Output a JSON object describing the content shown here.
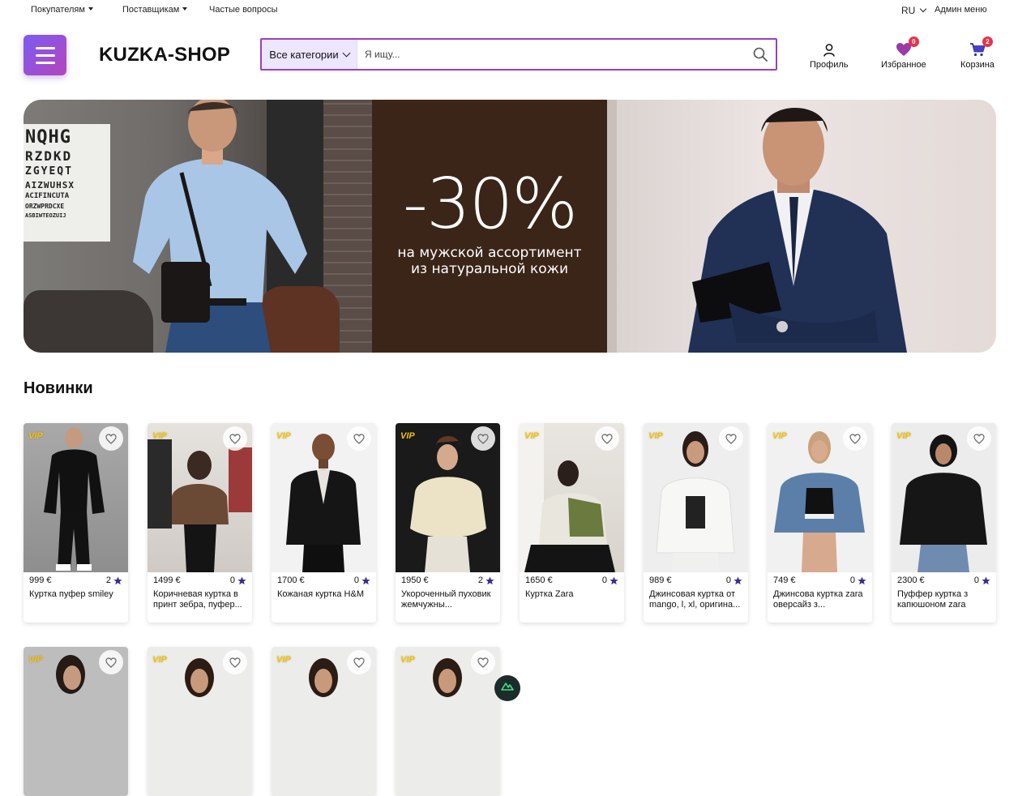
{
  "topbar": {
    "buyers": "Покупателям",
    "suppliers": "Поставщикам",
    "faq": "Частые вопросы",
    "lang": "RU",
    "admin": "Админ меню"
  },
  "header": {
    "logo": "KUZKA-SHOP",
    "category_select": "Все категории",
    "search_placeholder": "Я ищу...",
    "profile": "Профиль",
    "favorites": "Избранное",
    "favorites_count": "0",
    "cart": "Корзина",
    "cart_count": "2"
  },
  "banner": {
    "percent": "-30%",
    "line1": "на мужской ассортимент",
    "line2": "из натуральной кожи",
    "eye_chart": [
      "NQHG",
      "RZDKD",
      "ZGYEQT",
      "AIZWUHSX",
      "ACIFINCUTA",
      "ORZWPRDCXE",
      "ASBIWTEOZUIJ"
    ]
  },
  "section": {
    "title": "Новинки"
  },
  "vip_label": "VIP",
  "products": [
    {
      "price": "999 €",
      "rating": "2",
      "name": "Куртка пуфер smiley"
    },
    {
      "price": "1499 €",
      "rating": "0",
      "name": "Коричневая куртка в принт зебра, пуфер..."
    },
    {
      "price": "1700 €",
      "rating": "0",
      "name": "Кожаная куртка H&M"
    },
    {
      "price": "1950 €",
      "rating": "2",
      "name": "Укороченный пуховик жемчужны..."
    },
    {
      "price": "1650 €",
      "rating": "0",
      "name": "Куртка Zara"
    },
    {
      "price": "989 €",
      "rating": "0",
      "name": "Джинсовая куртка от mango, l, xl, оригина..."
    },
    {
      "price": "749 €",
      "rating": "0",
      "name": "Джинсова куртка zara оверсайз з..."
    },
    {
      "price": "2300 €",
      "rating": "0",
      "name": "Пуффер куртка з капюшоном zara"
    }
  ],
  "colors": {
    "accent": "#9a3fc0",
    "badge": "#e8324a",
    "vip": "#f6c200",
    "star": "#3b2f8a"
  }
}
